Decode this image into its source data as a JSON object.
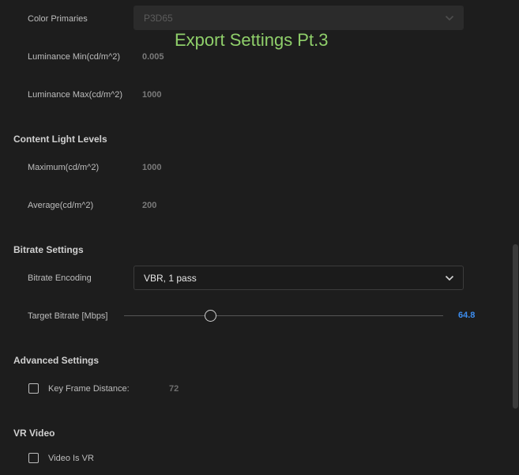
{
  "overlay": {
    "title": "Export Settings Pt.3"
  },
  "hdr": {
    "color_primaries": {
      "label": "Color Primaries",
      "value": "P3D65"
    },
    "luminance_min": {
      "label": "Luminance Min(cd/m^2)",
      "value": "0.005"
    },
    "luminance_max": {
      "label": "Luminance Max(cd/m^2)",
      "value": "1000"
    }
  },
  "content_light": {
    "title": "Content Light Levels",
    "maximum": {
      "label": "Maximum(cd/m^2)",
      "value": "1000"
    },
    "average": {
      "label": "Average(cd/m^2)",
      "value": "200"
    }
  },
  "bitrate": {
    "title": "Bitrate Settings",
    "encoding": {
      "label": "Bitrate Encoding",
      "value": "VBR, 1 pass"
    },
    "target": {
      "label": "Target Bitrate [Mbps]",
      "value": "64.8",
      "slider_fraction": 0.27
    }
  },
  "advanced": {
    "title": "Advanced Settings",
    "key_frame": {
      "label": "Key Frame Distance:",
      "value": "72",
      "checked": false
    }
  },
  "vr": {
    "title": "VR Video",
    "video_is_vr": {
      "label": "Video Is VR",
      "checked": false
    }
  },
  "colors": {
    "accent": "#3d8ef0",
    "overlay_text": "#8fcf6a",
    "background": "#1d1d1d"
  }
}
